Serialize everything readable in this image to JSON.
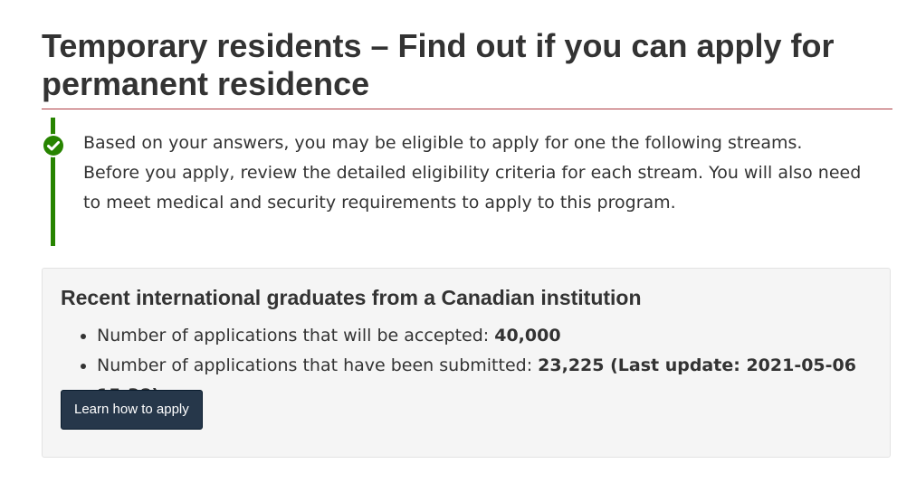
{
  "page": {
    "title": "Temporary residents – Find out if you can apply for permanent residence"
  },
  "alert": {
    "status": "success",
    "icon": "check-circle-icon",
    "color": "#278400",
    "line1": "Based on your answers, you may be eligible to apply for one the following streams.",
    "line2": "Before you apply, review the detailed eligibility criteria for each stream. You will also need to meet medical and security requirements to apply to this program."
  },
  "stream": {
    "heading": "Recent international graduates from a Canadian institution",
    "items": [
      {
        "label": "Number of applications that will be accepted: ",
        "value": "40,000"
      },
      {
        "label": "Number of applications that have been submitted: ",
        "value": "23,225 (Last update: 2021-05-06 15:38)"
      }
    ],
    "button_label": "Learn how to apply"
  },
  "colors": {
    "rule": "#af3c43",
    "button_bg": "#26374a",
    "panel_bg": "#f5f5f5"
  }
}
